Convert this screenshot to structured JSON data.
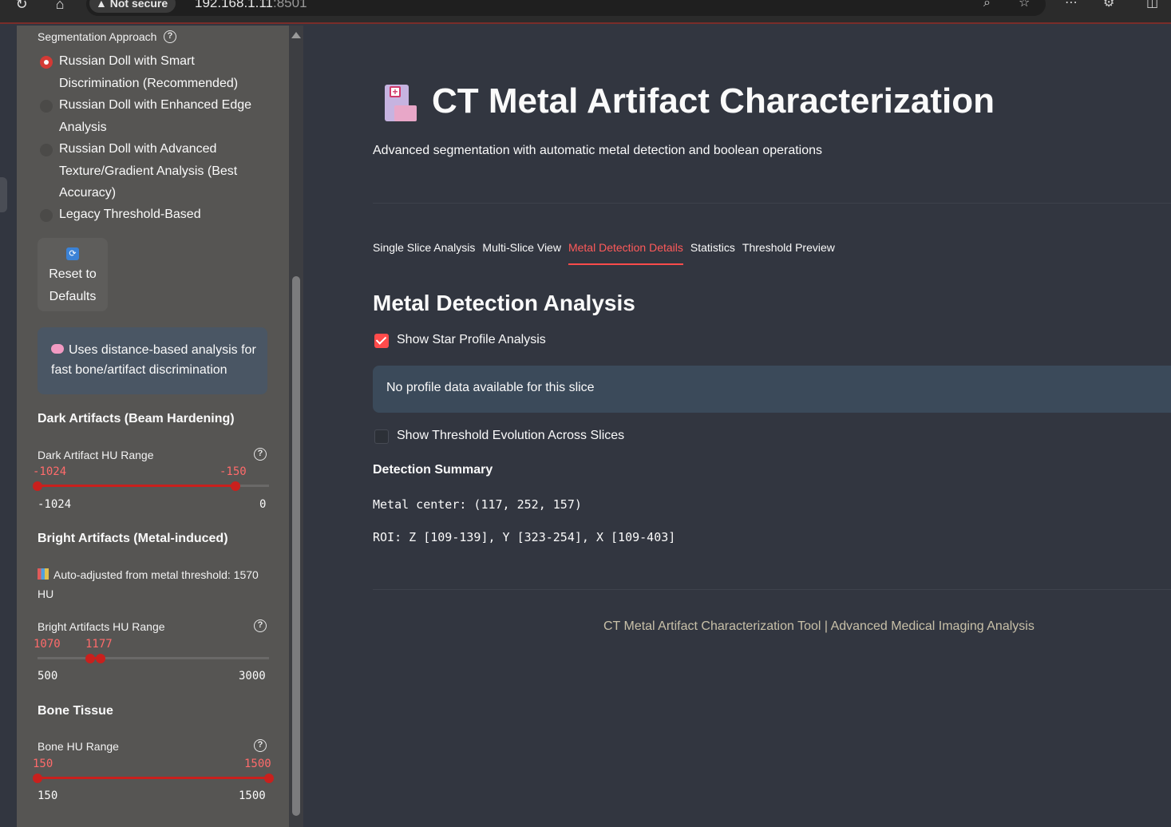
{
  "browser": {
    "security": "Not secure",
    "url_host": "192.168.1.11",
    "url_port": ":8501"
  },
  "sidebar": {
    "segmentation_label": "Segmentation Approach",
    "approaches": [
      {
        "label": "Russian Doll with Smart Discrimination (Recommended)",
        "selected": true
      },
      {
        "label": "Russian Doll with Enhanced Edge Analysis",
        "selected": false
      },
      {
        "label": "Russian Doll with Advanced Texture/Gradient Analysis (Best Accuracy)",
        "selected": false
      },
      {
        "label": "Legacy Threshold-Based",
        "selected": false
      }
    ],
    "reset_button": "Reset to Defaults",
    "info_text": "Uses distance-based analysis for fast bone/artifact discrimination",
    "dark": {
      "heading": "Dark Artifacts (Beam Hardening)",
      "slider_label": "Dark Artifact HU Range",
      "low": "-1024",
      "high": "-150",
      "min": "-1024",
      "max": "0",
      "fraction_low": 0.0,
      "fraction_high": 0.8535
    },
    "bright": {
      "heading": "Bright Artifacts (Metal-induced)",
      "note": "Auto-adjusted from metal threshold: 1570 HU",
      "slider_label": "Bright Artifacts HU Range",
      "low": "1070",
      "high": "1177",
      "min": "500",
      "max": "3000",
      "fraction_low": 0.228,
      "fraction_high": 0.2708
    },
    "bone": {
      "heading": "Bone Tissue",
      "slider_label": "Bone HU Range",
      "low": "150",
      "high": "1500",
      "min": "150",
      "max": "1500",
      "fraction_low": 0.0,
      "fraction_high": 1.0
    }
  },
  "main": {
    "title": "CT Metal Artifact Characterization",
    "subtitle": "Advanced segmentation with automatic metal detection and boolean operations",
    "tabs": [
      {
        "label": "Single Slice Analysis",
        "active": false
      },
      {
        "label": "Multi-Slice View",
        "active": false
      },
      {
        "label": "Metal Detection Details",
        "active": true
      },
      {
        "label": "Statistics",
        "active": false
      },
      {
        "label": "Threshold Preview",
        "active": false
      }
    ],
    "section_title": "Metal Detection Analysis",
    "star_profile_checkbox": {
      "label": "Show Star Profile Analysis",
      "checked": true
    },
    "alert": "No profile data available for this slice",
    "threshold_evolution_checkbox": {
      "label": "Show Threshold Evolution Across Slices",
      "checked": false
    },
    "summary_heading": "Detection Summary",
    "metal_center": "Metal center: (117, 252, 157)",
    "roi": "ROI: Z [109-139], Y [323-254], X [109-403]",
    "footer": "CT Metal Artifact Characterization Tool | Advanced Medical Imaging Analysis"
  },
  "colors": {
    "accent": "#ff4b4b",
    "sidebar_bg": "#565553",
    "main_bg": "#323640",
    "info_bg": "#4a5664",
    "alert_bg": "#3b4a5a"
  }
}
